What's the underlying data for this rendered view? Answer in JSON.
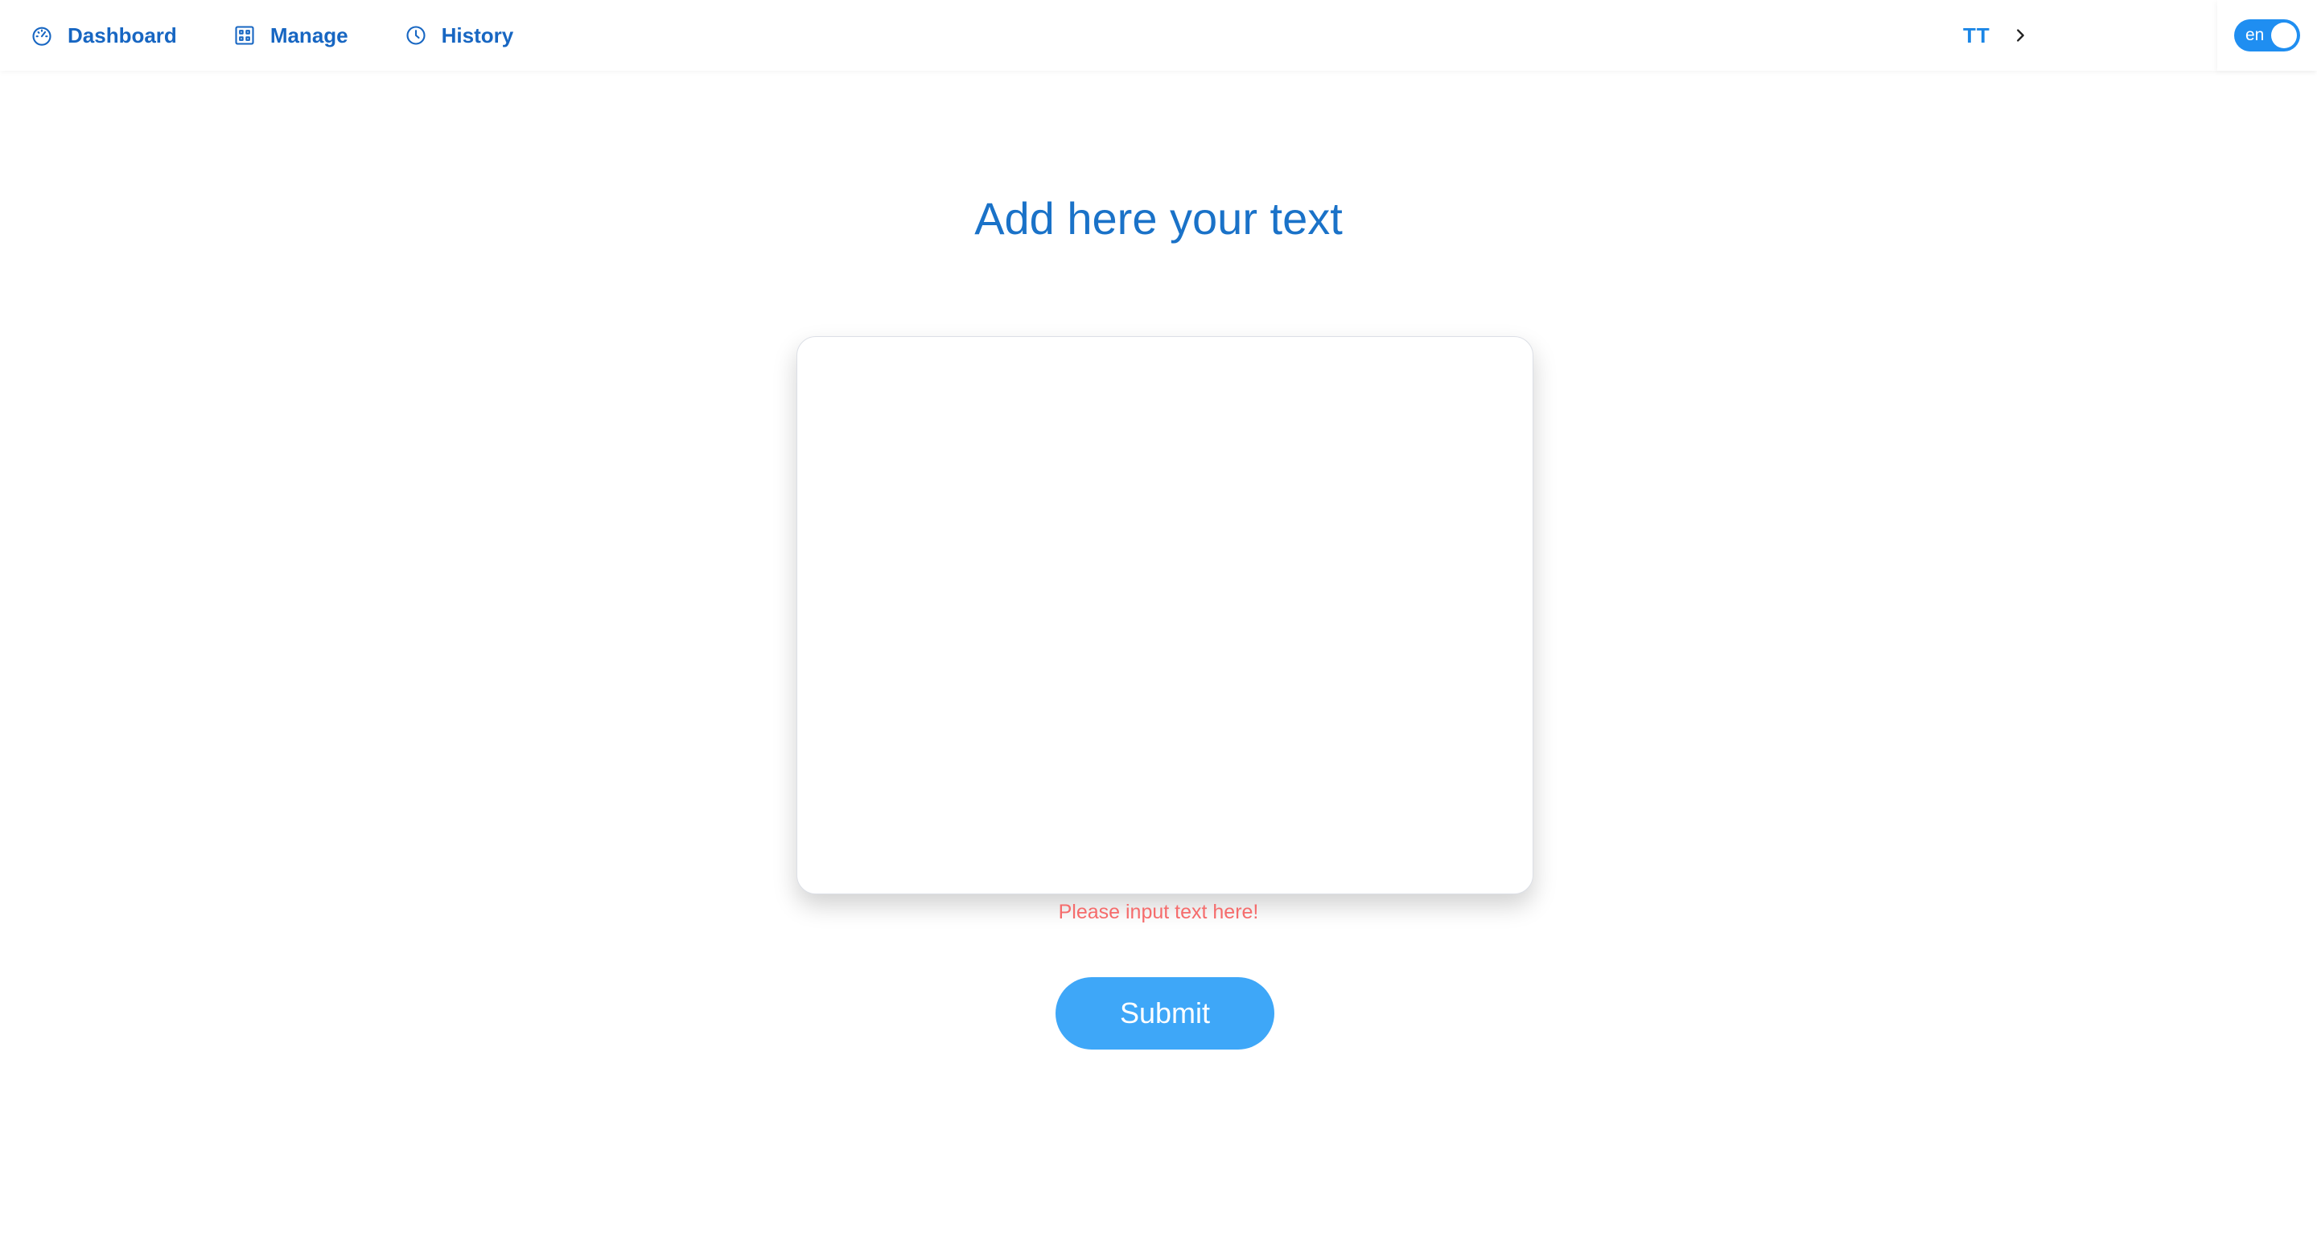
{
  "nav": {
    "items": [
      {
        "label": "Dashboard",
        "icon": "dashboard-gauge-icon"
      },
      {
        "label": "Manage",
        "icon": "grid-icon"
      },
      {
        "label": "History",
        "icon": "clock-icon"
      }
    ]
  },
  "user": {
    "initials": "TT",
    "chevron_icon": "chevron-right-icon"
  },
  "language": {
    "label": "en",
    "enabled": true
  },
  "main": {
    "title": "Add here your text",
    "textarea_value": "",
    "error_message": "Please input text here!",
    "submit_label": "Submit"
  },
  "colors": {
    "nav_text": "#1766c2",
    "accent": "#1f8ef1",
    "button": "#3ea7f8",
    "error": "#f56c6c",
    "title": "#1a72c8"
  }
}
